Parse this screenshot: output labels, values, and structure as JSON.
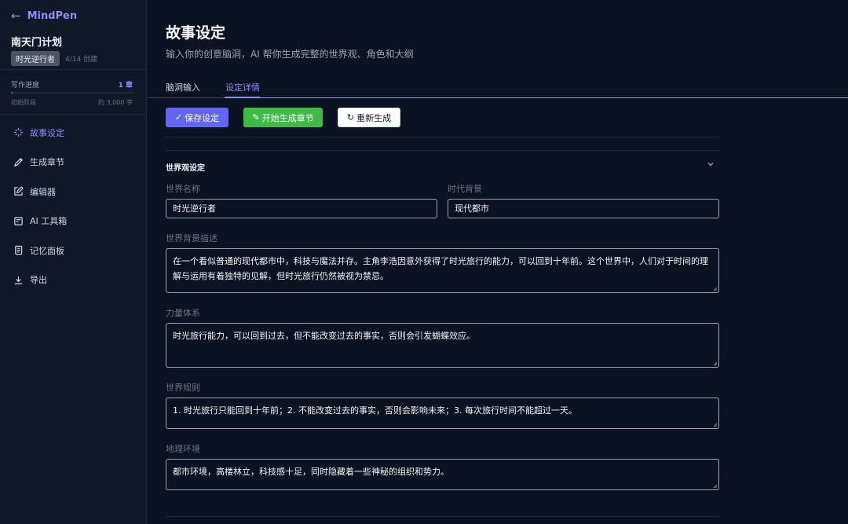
{
  "sidebar": {
    "brand": "MindPen",
    "project_title": "南天门计划",
    "tag": "时光逆行者",
    "created": "4/14 创建",
    "progress": {
      "label": "写作进度",
      "value": "1 章",
      "fraction": 0.005,
      "stage": "初始阶段",
      "words": "约 3,000 字"
    },
    "items": [
      {
        "label": "故事设定",
        "icon": "sparkle-icon",
        "active": true
      },
      {
        "label": "生成章节",
        "icon": "pen-icon",
        "active": false
      },
      {
        "label": "编辑器",
        "icon": "edit-icon",
        "active": false
      },
      {
        "label": "AI 工具箱",
        "icon": "toolbox-icon",
        "active": false
      },
      {
        "label": "记忆面板",
        "icon": "notebook-icon",
        "active": false
      },
      {
        "label": "导出",
        "icon": "download-icon",
        "active": false
      }
    ]
  },
  "main": {
    "title": "故事设定",
    "subtitle": "输入你的创意脑洞，AI 帮你生成完整的世界观、角色和大纲",
    "tabs": [
      {
        "label": "脑洞输入",
        "active": false
      },
      {
        "label": "设定详情",
        "active": true
      }
    ],
    "actions": {
      "save": "保存设定",
      "generate": "开始生成章节",
      "regenerate": "重新生成"
    },
    "section_title": "世界观设定",
    "fields": {
      "world_name": {
        "label": "世界名称",
        "value": "时光逆行者"
      },
      "era": {
        "label": "时代背景",
        "value": "现代都市"
      },
      "background": {
        "label": "世界背景描述",
        "value": "在一个看似普通的现代都市中，科技与魔法并存。主角李浩因意外获得了时光旅行的能力，可以回到十年前。这个世界中，人们对于时间的理解与运用有着独特的见解，但时光旅行仍然被视为禁忌。"
      },
      "power": {
        "label": "力量体系",
        "value": "时光旅行能力，可以回到过去，但不能改变过去的事实，否则会引发蝴蝶效应。"
      },
      "rules": {
        "label": "世界规则",
        "value": "1. 时光旅行只能回到十年前；2. 不能改变过去的事实，否则会影响未来；3. 每次旅行时间不能超过一天。"
      },
      "geo": {
        "label": "地理环境",
        "value": "都市环境，高楼林立，科技感十足，同时隐藏着一些神秘的组织和势力。"
      }
    }
  },
  "colors": {
    "accent": "#8b8ef5",
    "primary_button": "#6366f1",
    "success_button": "#3fba48",
    "background": "#0b1222",
    "sidebar": "#111827"
  }
}
